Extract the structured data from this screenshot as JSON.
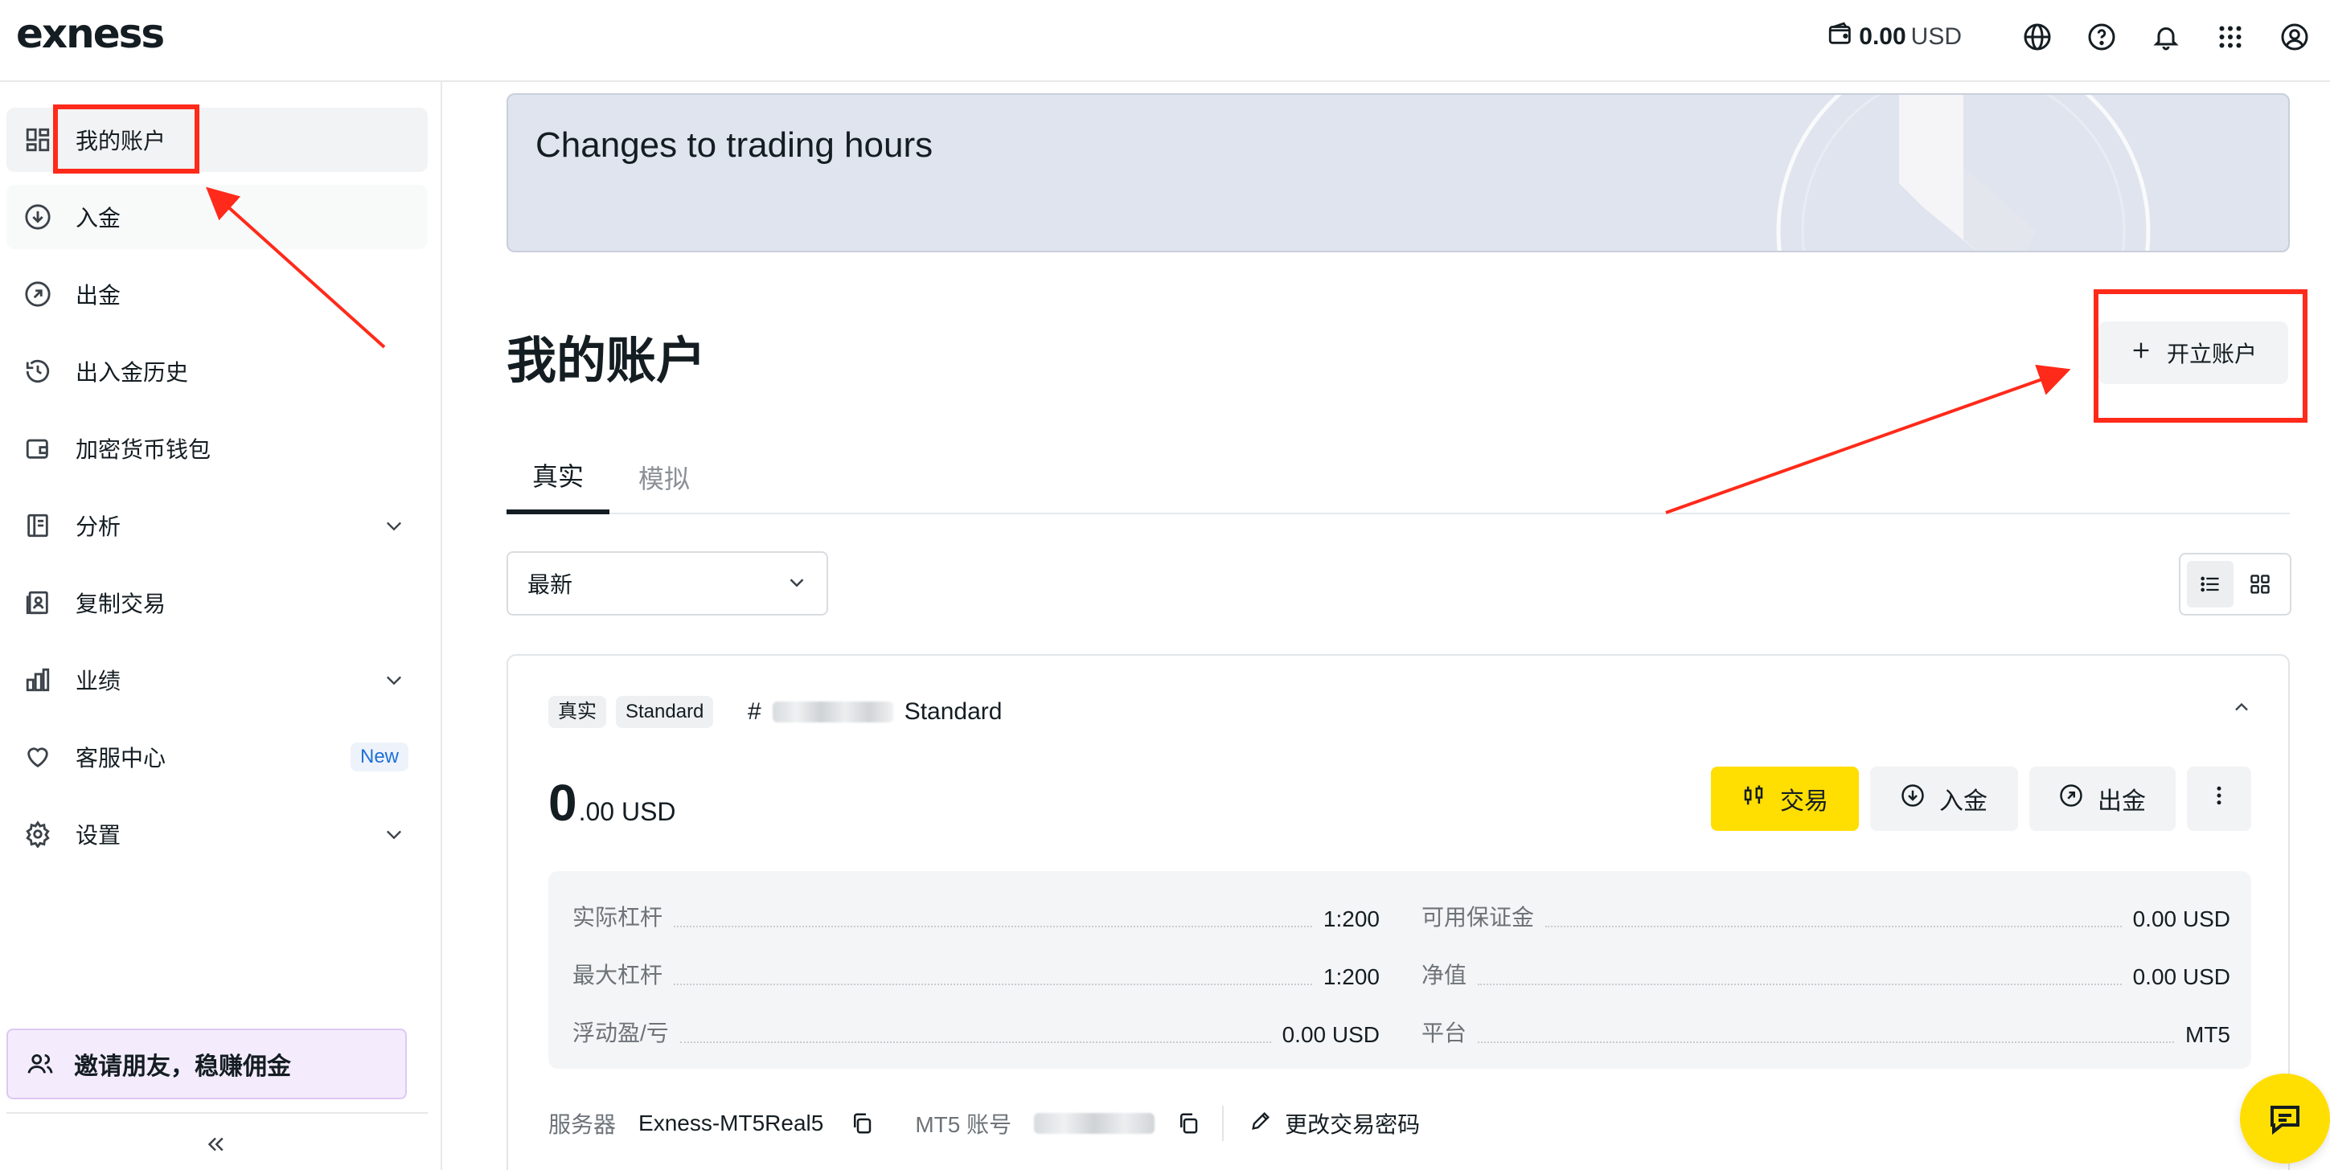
{
  "brand": {
    "logo_text": "exness"
  },
  "header": {
    "balance_amount": "0.00",
    "balance_currency": "USD",
    "icons": [
      "wallet-icon",
      "globe-icon",
      "help-icon",
      "bell-icon",
      "apps-grid-icon",
      "user-account-icon"
    ]
  },
  "sidebar": {
    "items": [
      {
        "label": "我的账户",
        "icon": "dashboard-icon"
      },
      {
        "label": "入金",
        "icon": "deposit-icon"
      },
      {
        "label": "出金",
        "icon": "withdraw-icon"
      },
      {
        "label": "出入金历史",
        "icon": "history-icon"
      },
      {
        "label": "加密货币钱包",
        "icon": "wallet-icon"
      },
      {
        "label": "分析",
        "icon": "analytics-icon",
        "expandable": true
      },
      {
        "label": "复制交易",
        "icon": "copy-trading-icon"
      },
      {
        "label": "业绩",
        "icon": "performance-chart-icon",
        "expandable": true
      },
      {
        "label": "客服中心",
        "icon": "heart-icon",
        "badge": "New"
      },
      {
        "label": "设置",
        "icon": "gear-icon",
        "expandable": true
      }
    ],
    "invite_label": "邀请朋友，稳赚佣金"
  },
  "banner": {
    "title": "Changes to trading hours"
  },
  "main": {
    "title": "我的账户",
    "open_account_label": "开立账户",
    "tabs": [
      "真实",
      "模拟"
    ],
    "sort_value": "最新"
  },
  "account": {
    "chips": [
      "真实",
      "Standard"
    ],
    "number_prefix": "#",
    "type_label": "Standard",
    "balance_int": "0",
    "balance_dec": ".00 USD",
    "actions": {
      "trade": "交易",
      "deposit": "入金",
      "withdraw": "出金"
    },
    "stats": [
      {
        "k": "实际杠杆",
        "v": "1:200"
      },
      {
        "k": "可用保证金",
        "v": "0.00 USD"
      },
      {
        "k": "最大杠杆",
        "v": "1:200"
      },
      {
        "k": "净值",
        "v": "0.00 USD"
      },
      {
        "k": "浮动盈/亏",
        "v": "0.00 USD"
      },
      {
        "k": "平台",
        "v": "MT5"
      }
    ],
    "server_label": "服务器",
    "server_value": "Exness-MT5Real5",
    "mt5_label": "MT5 账号",
    "change_password": "更改交易密码"
  },
  "colors": {
    "accent_yellow": "#ffde02",
    "annotation_red": "#ff2a1a",
    "banner_bg": "#dfe4ee"
  }
}
